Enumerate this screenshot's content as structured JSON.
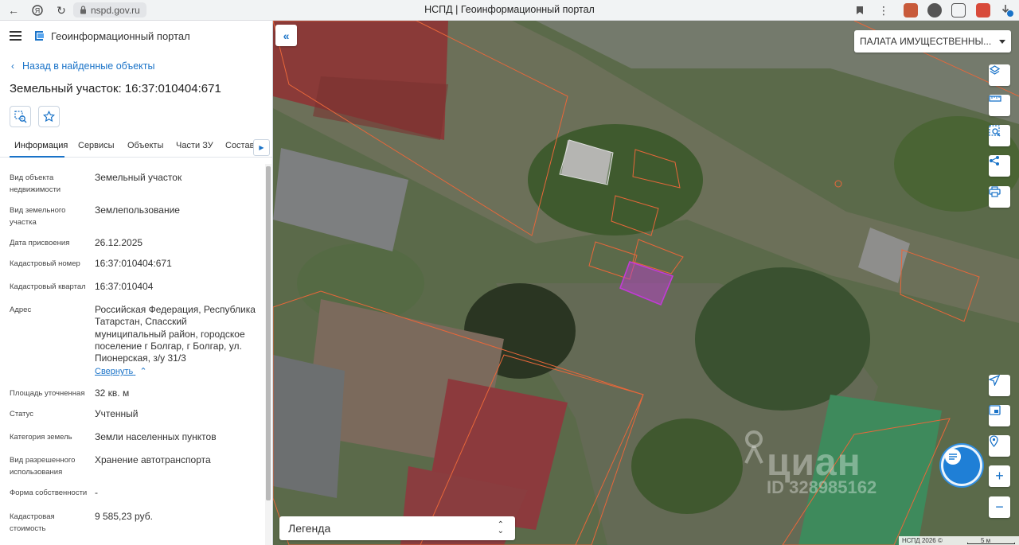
{
  "browser": {
    "url": "nspd.gov.ru",
    "tab_title": "НСПД | Геоинформационный портал"
  },
  "panel": {
    "portal_title": "Геоинформационный портал",
    "back_link": "Назад в найденные объекты",
    "object_title": "Земельный участок: 16:37:010404:671",
    "tabs": [
      "Информация",
      "Сервисы",
      "Объекты",
      "Части ЗУ",
      "Состав"
    ],
    "active_tab": "Информация",
    "attributes": [
      {
        "label": "Вид объекта недвижимости",
        "value": "Земельный участок"
      },
      {
        "label": "Вид земельного участка",
        "value": "Землепользование"
      },
      {
        "label": "Дата присвоения",
        "value": "26.12.2025"
      },
      {
        "label": "Кадастровый номер",
        "value": "16:37:010404:671"
      },
      {
        "label": "Кадастровый квартал",
        "value": "16:37:010404"
      },
      {
        "label": "Адрес",
        "value": "Российская Федерация, Республика Татарстан, Спасский муниципальный район, городское поселение г Болгар, г Болгар, ул. Пионерская, з/у 31/3"
      },
      {
        "label": "Площадь уточненная",
        "value": "32 кв. м"
      },
      {
        "label": "Статус",
        "value": "Учтенный"
      },
      {
        "label": "Категория земель",
        "value": "Земли населенных пунктов"
      },
      {
        "label": "Вид разрешенного использования",
        "value": "Хранение автотранспорта"
      },
      {
        "label": "Форма собственности",
        "value": "-"
      },
      {
        "label": "Кадастровая стоимость",
        "value": "9 585,23 руб."
      }
    ],
    "collapse_label": "Свернуть"
  },
  "map": {
    "layer_select": "ПАЛАТА ИМУЩЕСТВЕННЫ...",
    "legend_label": "Легенда",
    "watermark_brand": "циан",
    "watermark_id": "ID 328985162",
    "copyright": "НСПД 2026 ©",
    "scale_label": "5 м",
    "parcel_color": "#e8673a",
    "selected_color": "#c23bd6"
  }
}
